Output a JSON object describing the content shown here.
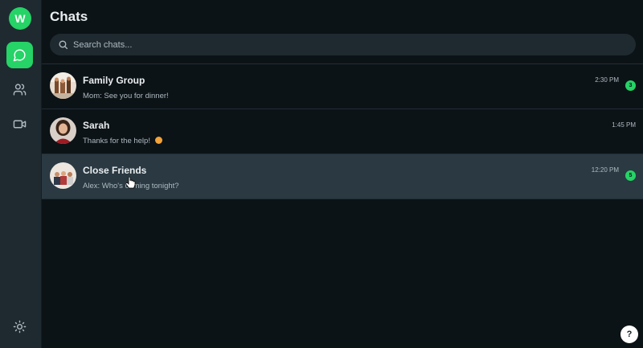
{
  "user": {
    "initial": "W",
    "accent": "#25d366"
  },
  "rail": {
    "items": [
      {
        "icon": "chat-icon",
        "active": true
      },
      {
        "icon": "contacts-icon",
        "active": false
      },
      {
        "icon": "video-icon",
        "active": false
      }
    ],
    "bottom_icon": "theme-toggle-sun-icon"
  },
  "header": {
    "title": "Chats"
  },
  "search": {
    "placeholder": "Search chats..."
  },
  "chats": [
    {
      "name": "Family Group",
      "preview": "Mom: See you for dinner!",
      "time": "2:30 PM",
      "unread": "3"
    },
    {
      "name": "Sarah",
      "preview": "Thanks for the help! ",
      "time": "1:45 PM",
      "unread": ""
    },
    {
      "name": "Close Friends",
      "preview": "Alex: Who's coming tonight?",
      "time": "12:20 PM",
      "unread": "5"
    }
  ],
  "help": {
    "label": "?"
  }
}
